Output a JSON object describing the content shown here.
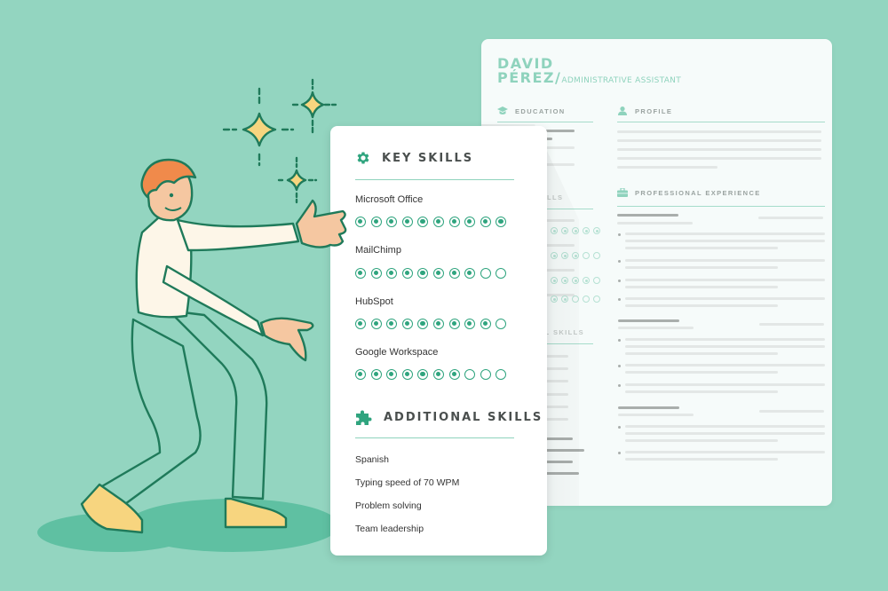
{
  "colors": {
    "background": "#93d5c0",
    "accent": "#2fa47e",
    "resume_accent": "#8fd3bd",
    "shadow_ellipse": "#5fc0a2",
    "hair": "#f08a4b",
    "sparkle": "#f7d57f",
    "outline": "#1f7a5a"
  },
  "resume": {
    "first_name": "DAVID",
    "last_name": "PÉREZ/",
    "role": "ADMINISTRATIVE ASSISTANT",
    "sections": {
      "education": "EDUCATION",
      "profile": "PROFILE",
      "key_skills_partial": "LLS",
      "additional_skills_partial": "NAL SKILLS",
      "professional_experience": "PROFESSIONAL EXPERIENCE"
    },
    "icons": {
      "education": "graduation-cap-icon",
      "profile": "person-icon",
      "experience": "briefcase-icon"
    },
    "skill_ratings_faded": [
      {
        "visible_filled": 5,
        "visible_total": 5
      },
      {
        "visible_filled": 3,
        "visible_total": 5
      },
      {
        "visible_filled": 4,
        "visible_total": 5
      },
      {
        "visible_filled": 2,
        "visible_total": 5
      }
    ]
  },
  "card": {
    "key_skills": {
      "title": "KEY SKILLS",
      "icon": "gear-icon",
      "max_rating": 10,
      "items": [
        {
          "name": "Microsoft Office",
          "rating": 10
        },
        {
          "name": "MailChimp",
          "rating": 8
        },
        {
          "name": "HubSpot",
          "rating": 9
        },
        {
          "name": "Google Workspace",
          "rating": 7
        }
      ]
    },
    "additional_skills": {
      "title": "ADDITIONAL SKILLS",
      "icon": "puzzle-icon",
      "items": [
        "Spanish",
        "Typing speed of 70 WPM",
        "Problem solving",
        "Team leadership"
      ]
    }
  },
  "illustration": {
    "subject": "man presenting resume",
    "sparkles": 3
  }
}
